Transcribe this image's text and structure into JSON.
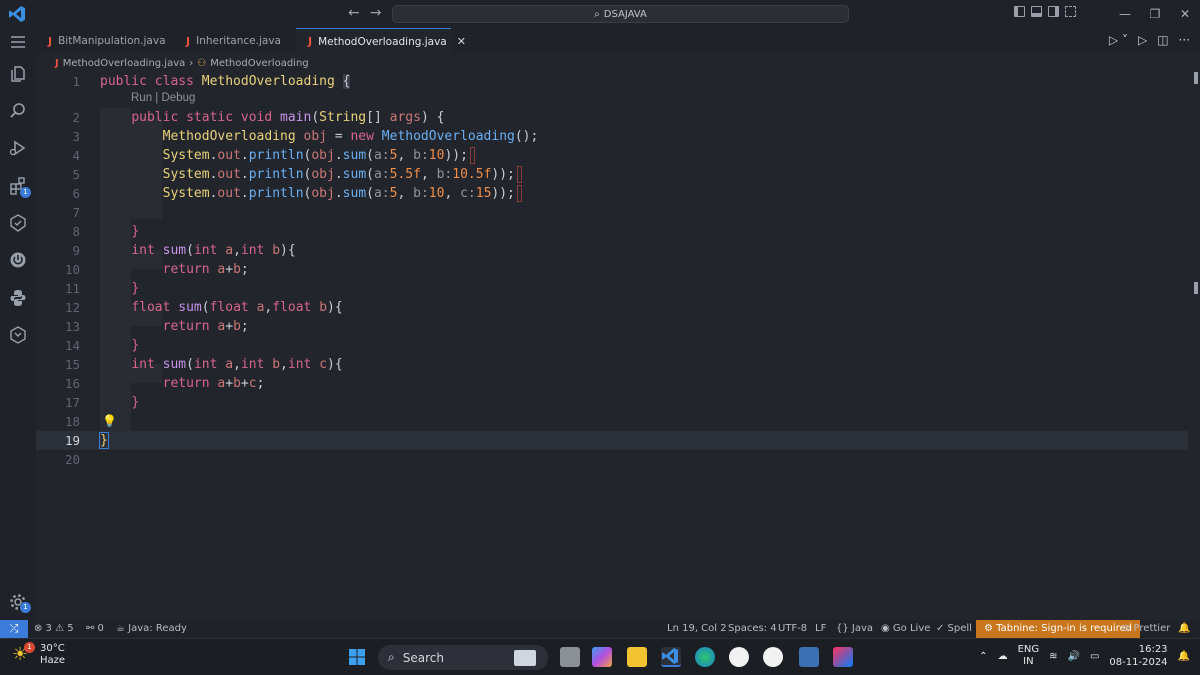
{
  "titlebar": {
    "search_text": "DSAJAVA",
    "back": "←",
    "forward": "→"
  },
  "tabs": [
    {
      "label": "BitManipulation.java"
    },
    {
      "label": "Inheritance.java"
    },
    {
      "label": "MethodOverloading.java",
      "active": true
    }
  ],
  "breadcrumb": {
    "file": "MethodOverloading.java",
    "symbol": "MethodOverloading"
  },
  "codelens": "Run | Debug",
  "line_numbers": [
    "1",
    "2",
    "3",
    "4",
    "5",
    "6",
    "7",
    "8",
    "9",
    "10",
    "11",
    "12",
    "13",
    "14",
    "15",
    "16",
    "17",
    "18",
    "19",
    "20"
  ],
  "statusbar": {
    "problems": "⊗ 3 ⚠ 5",
    "ports": "⚯ 0",
    "java_status": "Java: Ready",
    "cursor": "Ln 19, Col 2",
    "spaces": "Spaces: 4",
    "encoding": "UTF-8",
    "eol": "LF",
    "language": "{} Java",
    "go_live": "Go Live",
    "spell": "✓ Spell",
    "tabnine": "⚙ Tabnine: Sign-in is required",
    "prettier": "⊘ Prettier"
  },
  "activity_badges": {
    "extensions": "1",
    "settings": "1"
  },
  "taskbar": {
    "temperature": "30°C",
    "weather": "Haze",
    "weather_badge": "1",
    "search": "Search",
    "lang_top": "ENG",
    "lang_bottom": "IN",
    "time": "16:23",
    "date": "08-11-2024"
  },
  "colors": {
    "accent": "#3b7bd9",
    "tabnine": "#c9761c",
    "editor_bg": "#22252c"
  }
}
